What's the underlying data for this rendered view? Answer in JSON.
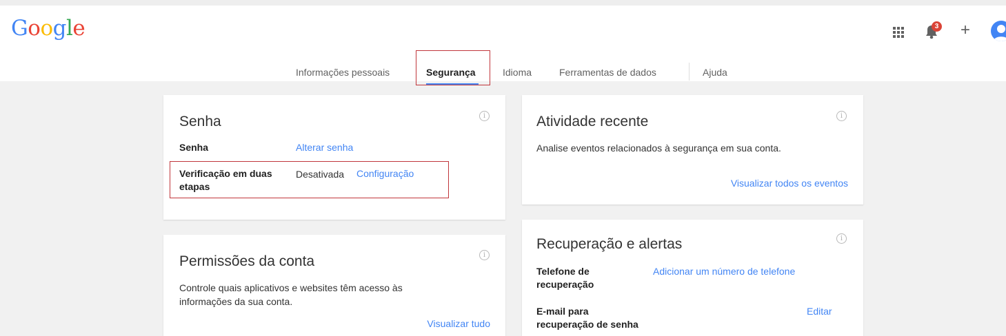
{
  "header": {
    "logo": {
      "G": "G",
      "o1": "o",
      "o2": "o",
      "g": "g",
      "l": "l",
      "e": "e"
    },
    "logo_colors": [
      "#4285f4",
      "#ea4335",
      "#fbbc05",
      "#4285f4",
      "#34a853",
      "#ea4335"
    ],
    "notification_count": "3",
    "plus_label": "+"
  },
  "nav": {
    "tabs": [
      {
        "label": "Informações pessoais"
      },
      {
        "label": "Segurança",
        "active": true
      },
      {
        "label": "Idioma"
      },
      {
        "label": "Ferramentas de dados"
      },
      {
        "label": "Ajuda"
      }
    ]
  },
  "cards": {
    "password": {
      "title": "Senha",
      "rows": [
        {
          "label": "Senha",
          "link": "Alterar senha"
        },
        {
          "label": "Verificação em duas etapas",
          "status": "Desativada",
          "link": "Configuração"
        }
      ]
    },
    "permissions": {
      "title": "Permissões da conta",
      "description": "Controle quais aplicativos e websites têm acesso às informações da sua conta.",
      "link": "Visualizar tudo"
    },
    "recent_activity": {
      "title": "Atividade recente",
      "description": "Analise eventos relacionados à segurança em sua conta.",
      "link": "Visualizar todos os eventos"
    },
    "recovery": {
      "title": "Recuperação e alertas",
      "rows": [
        {
          "label": "Telefone de recuperação",
          "link": "Adicionar um número de telefone"
        },
        {
          "label": "E-mail para recuperação de senha",
          "link": "Editar"
        }
      ]
    }
  },
  "colors": {
    "accent": "#4285f4",
    "highlight_box": "#c0353a",
    "notification_badge": "#db4437"
  }
}
